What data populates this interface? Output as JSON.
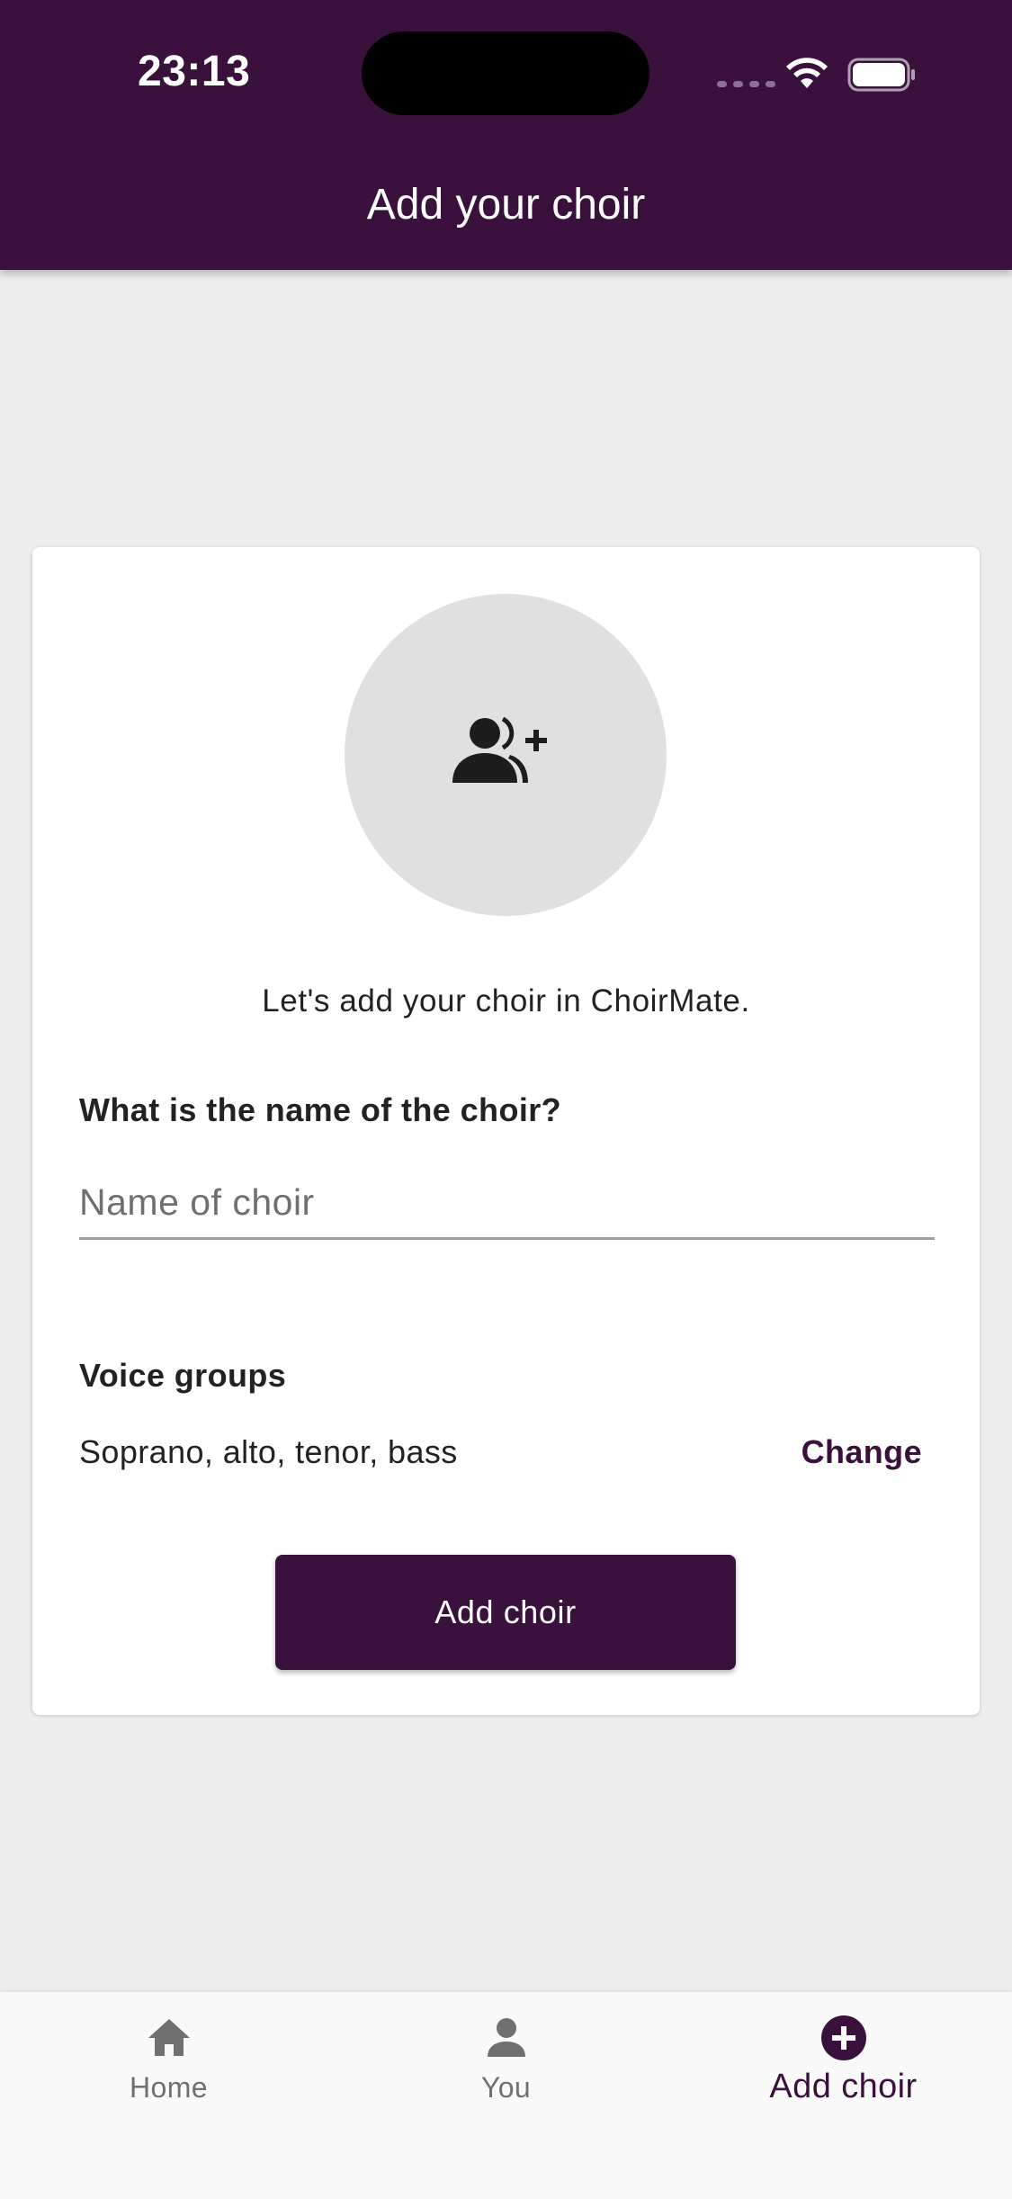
{
  "status_bar": {
    "time": "23:13"
  },
  "header": {
    "title": "Add your choir"
  },
  "card": {
    "avatar_icon": "group-add-icon",
    "intro_text": "Let's add your choir in ChoirMate.",
    "name_question": "What is the name of the choir?",
    "name_input": {
      "value": "",
      "placeholder": "Name of choir"
    },
    "voice_groups_label": "Voice groups",
    "voice_groups_value": "Soprano, alto, tenor, bass",
    "change_label": "Change",
    "submit_label": "Add choir"
  },
  "bottom_nav": {
    "items": [
      {
        "label": "Home",
        "icon": "home-icon",
        "active": false
      },
      {
        "label": "You",
        "icon": "person-icon",
        "active": false
      },
      {
        "label": "Add choir",
        "icon": "add-circle-icon",
        "active": true
      }
    ]
  },
  "colors": {
    "brand": "#3a103c",
    "background": "#ededed",
    "card": "#ffffff",
    "avatar_bg": "#e0e0e0",
    "inactive_nav": "#707070"
  }
}
